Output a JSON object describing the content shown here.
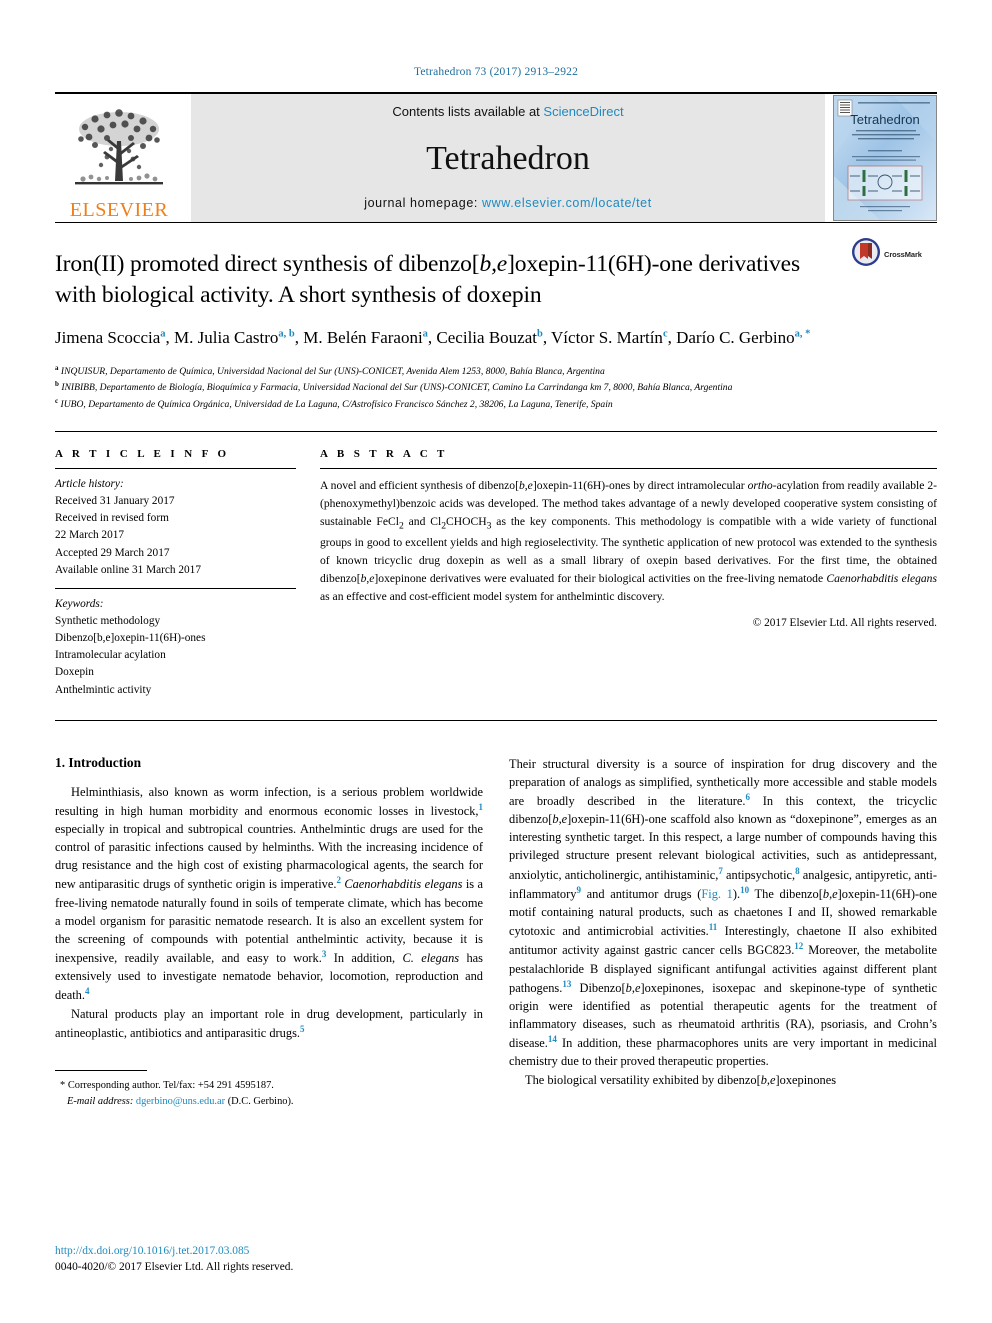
{
  "running_head": "Tetrahedron 73 (2017) 2913–2922",
  "masthead": {
    "publisher_name": "ELSEVIER",
    "contents_prefix": "Contents lists available at ",
    "contents_link": "ScienceDirect",
    "journal_name": "Tetrahedron",
    "homepage_label": "journal homepage: ",
    "homepage_url": "www.elsevier.com/locate/tet",
    "cover_title": "Tetrahedron"
  },
  "crossmark": {
    "label": "CrossMark"
  },
  "title": {
    "line1_a": "Iron(II) promoted direct synthesis of dibenzo[",
    "line1_b": "b,e",
    "line1_c": "]oxepin-11(6H)-one",
    "line2": "derivatives with biological activity. A short synthesis of doxepin"
  },
  "authors": [
    {
      "name": "Jimena Scoccia",
      "marks": "a",
      "sep": ", "
    },
    {
      "name": "M. Julia Castro",
      "marks": "a, b",
      "sep": ", "
    },
    {
      "name": "M. Belén Faraoni",
      "marks": "a",
      "sep": ", "
    },
    {
      "name": "Cecilia Bouzat",
      "marks": "b",
      "sep": ", "
    },
    {
      "name": "Víctor S. Martín",
      "marks": "c",
      "sep": ", "
    },
    {
      "name": "Darío C. Gerbino",
      "marks": "a, *",
      "sep": ""
    }
  ],
  "affiliations": [
    {
      "mark": "a",
      "text": "INQUISUR, Departamento de Química, Universidad Nacional del Sur (UNS)-CONICET, Avenida Alem 1253, 8000, Bahía Blanca, Argentina"
    },
    {
      "mark": "b",
      "text": "INIBIBB, Departamento de Biología, Bioquímica y Farmacia, Universidad Nacional del Sur (UNS)-CONICET, Camino La Carrindanga km 7, 8000, Bahía Blanca, Argentina"
    },
    {
      "mark": "c",
      "text": "IUBO, Departamento de Química Orgánica, Universidad de La Laguna, C/Astrofísico Francisco Sánchez 2, 38206, La Laguna, Tenerife, Spain"
    }
  ],
  "article_info": {
    "heading": "A R T I C L E  I N F O",
    "history_label": "Article history:",
    "history": [
      "Received 31 January 2017",
      "Received in revised form",
      "22 March 2017",
      "Accepted 29 March 2017",
      "Available online 31 March 2017"
    ],
    "keywords_label": "Keywords:",
    "keywords": [
      "Synthetic methodology",
      "Dibenzo[b,e]oxepin-11(6H)-ones",
      "Intramolecular acylation",
      "Doxepin",
      "Anthelmintic activity"
    ]
  },
  "abstract": {
    "heading": "A B S T R A C T",
    "copyright": "© 2017 Elsevier Ltd. All rights reserved."
  },
  "introduction": {
    "heading": "1.  Introduction"
  },
  "footnote": {
    "star": "*",
    "corresponding": "Corresponding author. Tel/fax: +54 291 4595187.",
    "email_label": "E-mail address:",
    "email": "dgerbino@uns.edu.ar",
    "email_suffix": "(D.C. Gerbino)."
  },
  "page_footer": {
    "doi": "http://dx.doi.org/10.1016/j.tet.2017.03.085",
    "issn_line": "0040-4020/© 2017 Elsevier Ltd. All rights reserved."
  },
  "colors": {
    "link": "#1f8ac0",
    "running_head": "#1f6f9e",
    "elsevier_orange": "#ef7f1a",
    "masthead_bg": "#e6e6e6"
  }
}
